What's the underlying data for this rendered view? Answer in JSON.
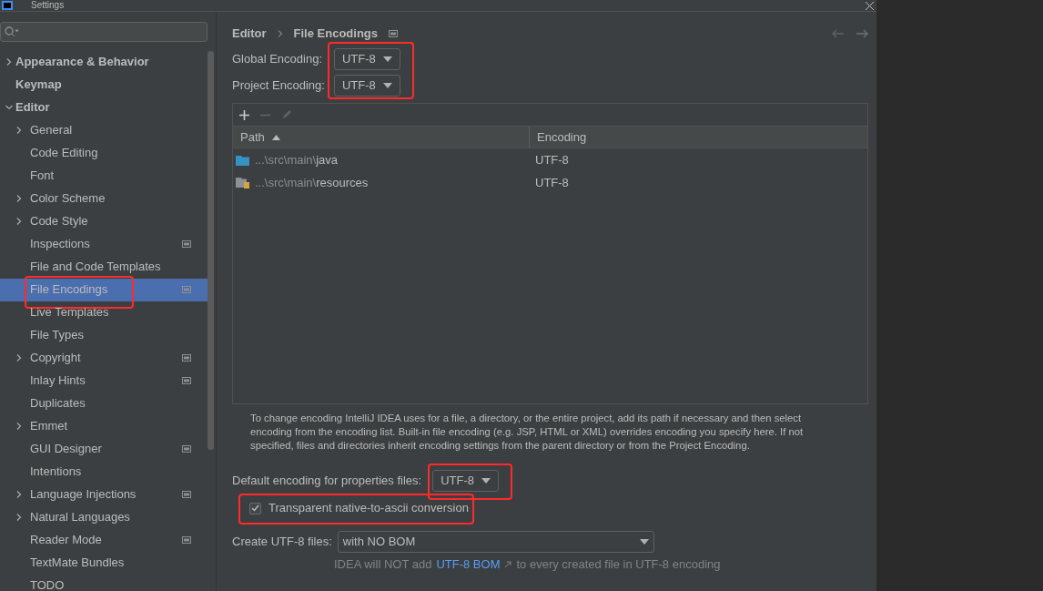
{
  "window": {
    "title": "Settings"
  },
  "sidebar": {
    "items": [
      {
        "label": "Appearance & Behavior",
        "expanded": false,
        "selected": false,
        "scoped": false,
        "highlighted": false
      },
      {
        "label": "Keymap",
        "selected": false,
        "scoped": false,
        "highlighted": false
      },
      {
        "label": "Editor",
        "expanded": true,
        "selected": false,
        "scoped": false,
        "highlighted": false,
        "children": [
          {
            "label": "General",
            "expanded": false,
            "selected": false,
            "scoped": false,
            "highlighted": false
          },
          {
            "label": "Code Editing",
            "selected": false,
            "scoped": false,
            "highlighted": false
          },
          {
            "label": "Font",
            "selected": false,
            "scoped": false,
            "highlighted": false
          },
          {
            "label": "Color Scheme",
            "expanded": false,
            "selected": false,
            "scoped": false,
            "highlighted": false
          },
          {
            "label": "Code Style",
            "expanded": false,
            "selected": false,
            "scoped": false,
            "highlighted": false
          },
          {
            "label": "Inspections",
            "selected": false,
            "scoped": true,
            "highlighted": false
          },
          {
            "label": "File and Code Templates",
            "selected": false,
            "scoped": false,
            "highlighted": false
          },
          {
            "label": "File Encodings",
            "selected": true,
            "scoped": true,
            "highlighted": true
          },
          {
            "label": "Live Templates",
            "selected": false,
            "scoped": false,
            "highlighted": false
          },
          {
            "label": "File Types",
            "selected": false,
            "scoped": false,
            "highlighted": false
          },
          {
            "label": "Copyright",
            "expanded": false,
            "selected": false,
            "scoped": true,
            "highlighted": false
          },
          {
            "label": "Inlay Hints",
            "selected": false,
            "scoped": true,
            "highlighted": false
          },
          {
            "label": "Duplicates",
            "selected": false,
            "scoped": false,
            "highlighted": false
          },
          {
            "label": "Emmet",
            "expanded": false,
            "selected": false,
            "scoped": false,
            "highlighted": false
          },
          {
            "label": "GUI Designer",
            "selected": false,
            "scoped": true,
            "highlighted": false
          },
          {
            "label": "Intentions",
            "selected": false,
            "scoped": false,
            "highlighted": false
          },
          {
            "label": "Language Injections",
            "expanded": false,
            "selected": false,
            "scoped": true,
            "highlighted": false
          },
          {
            "label": "Natural Languages",
            "expanded": false,
            "selected": false,
            "scoped": false,
            "highlighted": false
          },
          {
            "label": "Reader Mode",
            "selected": false,
            "scoped": true,
            "highlighted": false
          },
          {
            "label": "TextMate Bundles",
            "selected": false,
            "scoped": false,
            "highlighted": false
          },
          {
            "label": "TODO",
            "selected": false,
            "scoped": false,
            "highlighted": false
          }
        ]
      }
    ]
  },
  "breadcrumb": [
    "Editor",
    "File Encodings"
  ],
  "encodings": {
    "highlighted": true,
    "fields": [
      {
        "label": "Global Encoding:",
        "value": "UTF-8"
      },
      {
        "label": "Project Encoding:",
        "value": "UTF-8"
      }
    ]
  },
  "table": {
    "columns": [
      {
        "label": "Path",
        "sorted": true
      },
      {
        "label": "Encoding",
        "sorted": false
      }
    ],
    "rows": [
      {
        "kind": "source",
        "path_prefix": "...\\src\\main\\",
        "path_name": "java",
        "encoding": "UTF-8"
      },
      {
        "kind": "resources",
        "path_prefix": "...\\src\\main\\",
        "path_name": "resources",
        "encoding": "UTF-8"
      }
    ]
  },
  "description": "To change encoding IntelliJ IDEA uses for a file, a directory, or the entire project, add its path if necessary and then select encoding from the encoding list. Built-in file encoding (e.g. JSP, HTML or XML) overrides encoding you specify here. If not specified, files and directories inherit encoding settings from the parent directory or from the Project Encoding.",
  "properties_encoding": {
    "label": "Default encoding for properties files:",
    "value": "UTF-8",
    "highlighted": true
  },
  "native_to_ascii": {
    "label": "Transparent native-to-ascii conversion",
    "checked": true,
    "highlighted": true
  },
  "create_utf8": {
    "label": "Create UTF-8 files:",
    "value": "with NO BOM"
  },
  "hint": {
    "before": "IDEA will NOT add",
    "link": "UTF-8 BOM",
    "after": "to every created file in UTF-8 encoding"
  }
}
